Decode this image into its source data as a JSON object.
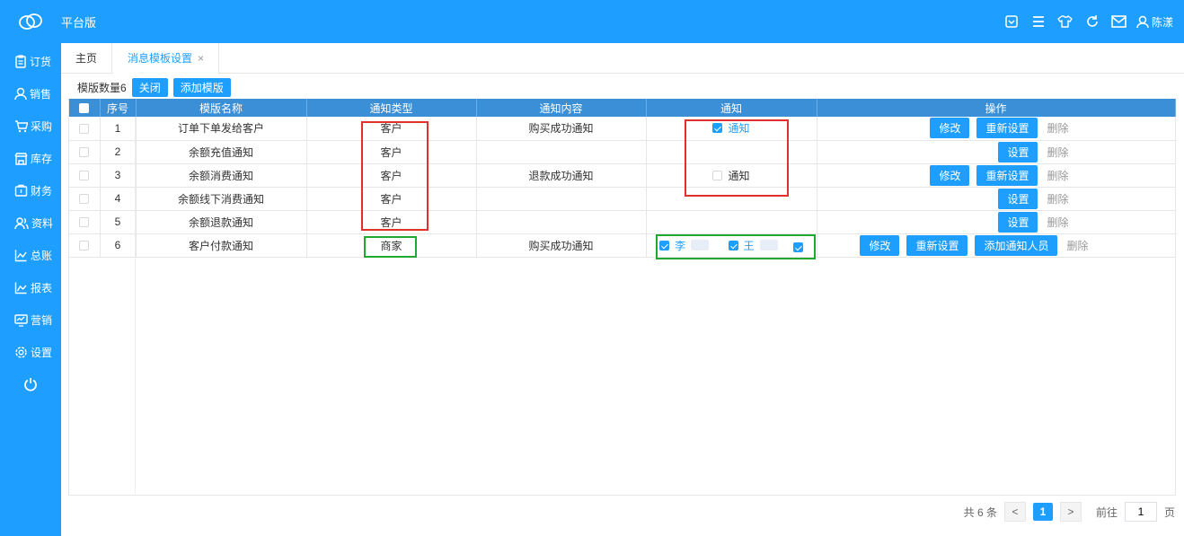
{
  "app": {
    "title": "平台版",
    "user_name": "陈漾"
  },
  "top_icons": [
    "dropdown-box-icon",
    "menu-icon",
    "shirt-icon",
    "refresh-icon",
    "mail-icon"
  ],
  "sidebar": {
    "items": [
      {
        "label": "订货",
        "icon": "clipboard-icon"
      },
      {
        "label": "销售",
        "icon": "person-icon"
      },
      {
        "label": "采购",
        "icon": "cart-icon"
      },
      {
        "label": "库存",
        "icon": "store-icon"
      },
      {
        "label": "财务",
        "icon": "safe-icon"
      },
      {
        "label": "资料",
        "icon": "people-icon"
      },
      {
        "label": "总账",
        "icon": "line-chart-icon"
      },
      {
        "label": "报表",
        "icon": "area-chart-icon"
      },
      {
        "label": "营销",
        "icon": "monitor-icon"
      },
      {
        "label": "设置",
        "icon": "gear-icon"
      }
    ],
    "power_icon": "power-icon"
  },
  "tabs": {
    "home": "主页",
    "active": "消息模板设置",
    "close": "×"
  },
  "toolbar": {
    "count_label": "模版数量6",
    "close_label": "关闭",
    "add_label": "添加模版"
  },
  "table": {
    "columns": [
      "序号",
      "模版名称",
      "通知类型",
      "通知内容",
      "通知",
      "操作"
    ],
    "rows": [
      {
        "no": "1",
        "name": "订单下单发给客户",
        "type": "客户",
        "content": "购买成功通知",
        "notify": {
          "label": "通知",
          "checked": true
        },
        "ops": [
          "修改",
          "重新设置",
          "删除"
        ]
      },
      {
        "no": "2",
        "name": "余额充值通知",
        "type": "客户",
        "content": "",
        "notify": null,
        "ops": [
          "设置",
          "删除"
        ]
      },
      {
        "no": "3",
        "name": "余额消费通知",
        "type": "客户",
        "content": "退款成功通知",
        "notify": {
          "label": "通知",
          "checked": false
        },
        "ops": [
          "修改",
          "重新设置",
          "删除"
        ]
      },
      {
        "no": "4",
        "name": "余额线下消费通知",
        "type": "客户",
        "content": "",
        "notify": null,
        "ops": [
          "设置",
          "删除"
        ]
      },
      {
        "no": "5",
        "name": "余额退款通知",
        "type": "客户",
        "content": "",
        "notify": null,
        "ops": [
          "设置",
          "删除"
        ]
      },
      {
        "no": "6",
        "name": "客户付款通知",
        "type": "商家",
        "content": "购买成功通知",
        "notify_people": [
          "李",
          "王"
        ],
        "ops": [
          "修改",
          "重新设置",
          "添加通知人员",
          "删除"
        ]
      }
    ]
  },
  "pager": {
    "total": "共 6 条",
    "prev": "<",
    "current": "1",
    "next": ">",
    "goto": "前往",
    "goto_value": "1",
    "page_unit": "页"
  },
  "colors": {
    "primary": "#1e9fff",
    "header": "#3b8fd6",
    "highlight_red": "#e0302b",
    "highlight_green": "#1fa832"
  }
}
